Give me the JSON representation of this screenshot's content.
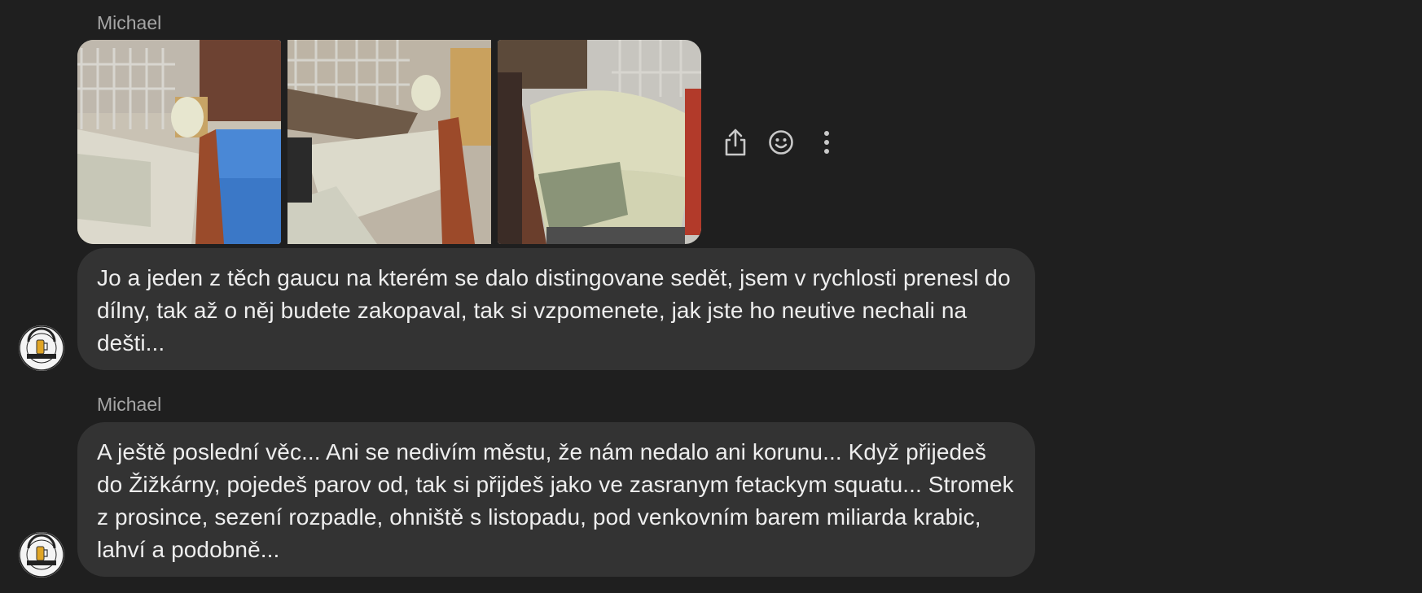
{
  "messages": [
    {
      "sender": "Michael",
      "photos": [
        {
          "name": "photo-1"
        },
        {
          "name": "photo-2"
        },
        {
          "name": "photo-3"
        }
      ],
      "text": "Jo a jeden z těch gaucu na kterém se dalo distingovane sedět, jsem v rychlosti prenesl do dílny, tak až o něj budete zakopaval, tak si vzpomenete, jak jste ho neutive nechali na dešti..."
    },
    {
      "sender": "Michael",
      "text": "A ještě poslední věc... Ani se nedivím městu, že nám nedalo ani korunu... Když přijedeš do Žižkárny, pojedeš parov od, tak si přijdeš jako ve zasranym fetackym squatu... Stromek z prosince, sezení rozpadle, ohniště s listopadu, pod venkovním barem miliarda krabic, lahví a podobně..."
    }
  ],
  "actions": [
    {
      "icon": "share-icon",
      "label": "Share"
    },
    {
      "icon": "emoji-icon",
      "label": "React"
    },
    {
      "icon": "more-icon",
      "label": "More"
    }
  ],
  "avatar": {
    "text_top": "CRAFT BEER PUB",
    "text_bottom": "ŽIŽKOVA ZAHRÁDKA"
  },
  "colors": {
    "background": "#1f1f1f",
    "bubble": "#333333",
    "sender": "#a6a6a6",
    "text": "#eeeeee"
  }
}
